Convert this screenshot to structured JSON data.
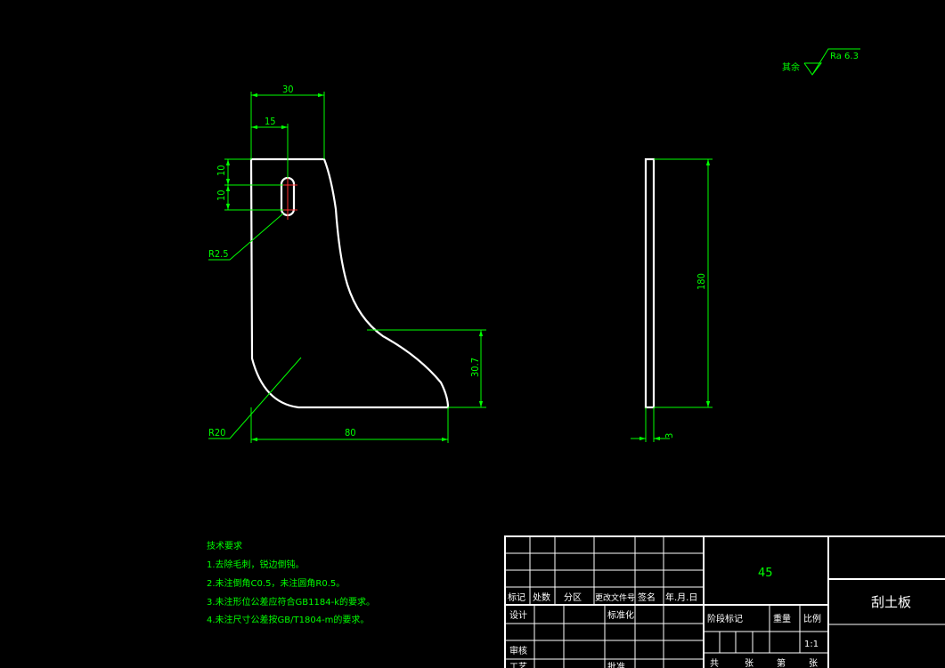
{
  "drawing": {
    "roughness": {
      "prefix": "其余",
      "value": "Ra 6.3"
    },
    "front_view": {
      "dims": {
        "width": "30",
        "slot_x": "15",
        "slot_y1": "10",
        "slot_y2": "10",
        "slot_radius": "R2.5",
        "corner_radius": "R20",
        "base": "80",
        "heel": "30.7"
      }
    },
    "side_view": {
      "dims": {
        "height": "180",
        "thickness": "3"
      }
    },
    "notes": {
      "title": "技术要求",
      "items": [
        "1.去除毛刺，锐边倒钝。",
        "2.未注倒角C0.5，未注圆角R0.5。",
        "3.未注形位公差应符合GB1184-k的要求。",
        "4.未注尺寸公差按GB/T1804-m的要求。"
      ]
    },
    "title_block": {
      "material": "45",
      "part_name": "刮土板",
      "rev_headers": [
        "标记",
        "处数",
        "分区",
        "更改文件号",
        "签名",
        "年.月.日"
      ],
      "roles": {
        "design": "设计",
        "standard": "标准化",
        "review": "审核",
        "process": "工艺",
        "approve": "批准"
      },
      "labels": {
        "stage": "阶段标记",
        "weight": "重量",
        "scale": "比例"
      },
      "scale_value": "1:1",
      "sheet": {
        "total": "共",
        "sheets1": "张",
        "no": "第",
        "sheets2": "张"
      }
    }
  }
}
